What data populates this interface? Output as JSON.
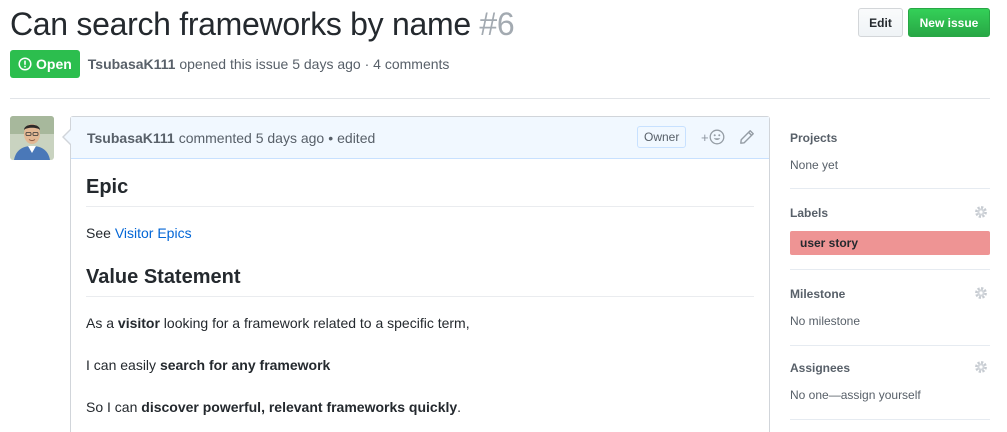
{
  "issue": {
    "title": "Can search frameworks by name",
    "number": "#6",
    "state": "Open",
    "author": "TsubasaK111",
    "meta_text": "opened this issue 5 days ago · 4 comments"
  },
  "header_buttons": {
    "edit_label": "Edit",
    "new_issue_label": "New issue"
  },
  "comment": {
    "author": "TsubasaK111",
    "action": "commented 5 days ago",
    "separator": "•",
    "edited": "edited",
    "owner_label": "Owner",
    "reaction_plus": "+",
    "body": {
      "heading_epic": "Epic",
      "see_prefix": "See ",
      "link_text": "Visitor Epics",
      "heading_value": "Value Statement",
      "p1_pre": "As a ",
      "p1_bold": "visitor",
      "p1_post": " looking for a framework related to a specific term,",
      "p2_pre": "I can easily ",
      "p2_bold": "search for any framework",
      "p3_pre": "So I can ",
      "p3_bold": "discover powerful, relevant frameworks quickly",
      "p3_post": "."
    }
  },
  "sidebar": {
    "projects": {
      "heading": "Projects",
      "value": "None yet"
    },
    "labels": {
      "heading": "Labels",
      "label": "user story",
      "label_color": "#ee9494"
    },
    "milestone": {
      "heading": "Milestone",
      "value": "No milestone"
    },
    "assignees": {
      "heading": "Assignees",
      "value": "No one—assign yourself"
    }
  },
  "colors": {
    "open_green": "#2cbe4e",
    "link_blue": "#0366d6",
    "header_blue": "#f1f8ff"
  },
  "icons": [
    "issue-opened-icon",
    "smiley-icon",
    "pencil-icon",
    "gear-icon"
  ]
}
